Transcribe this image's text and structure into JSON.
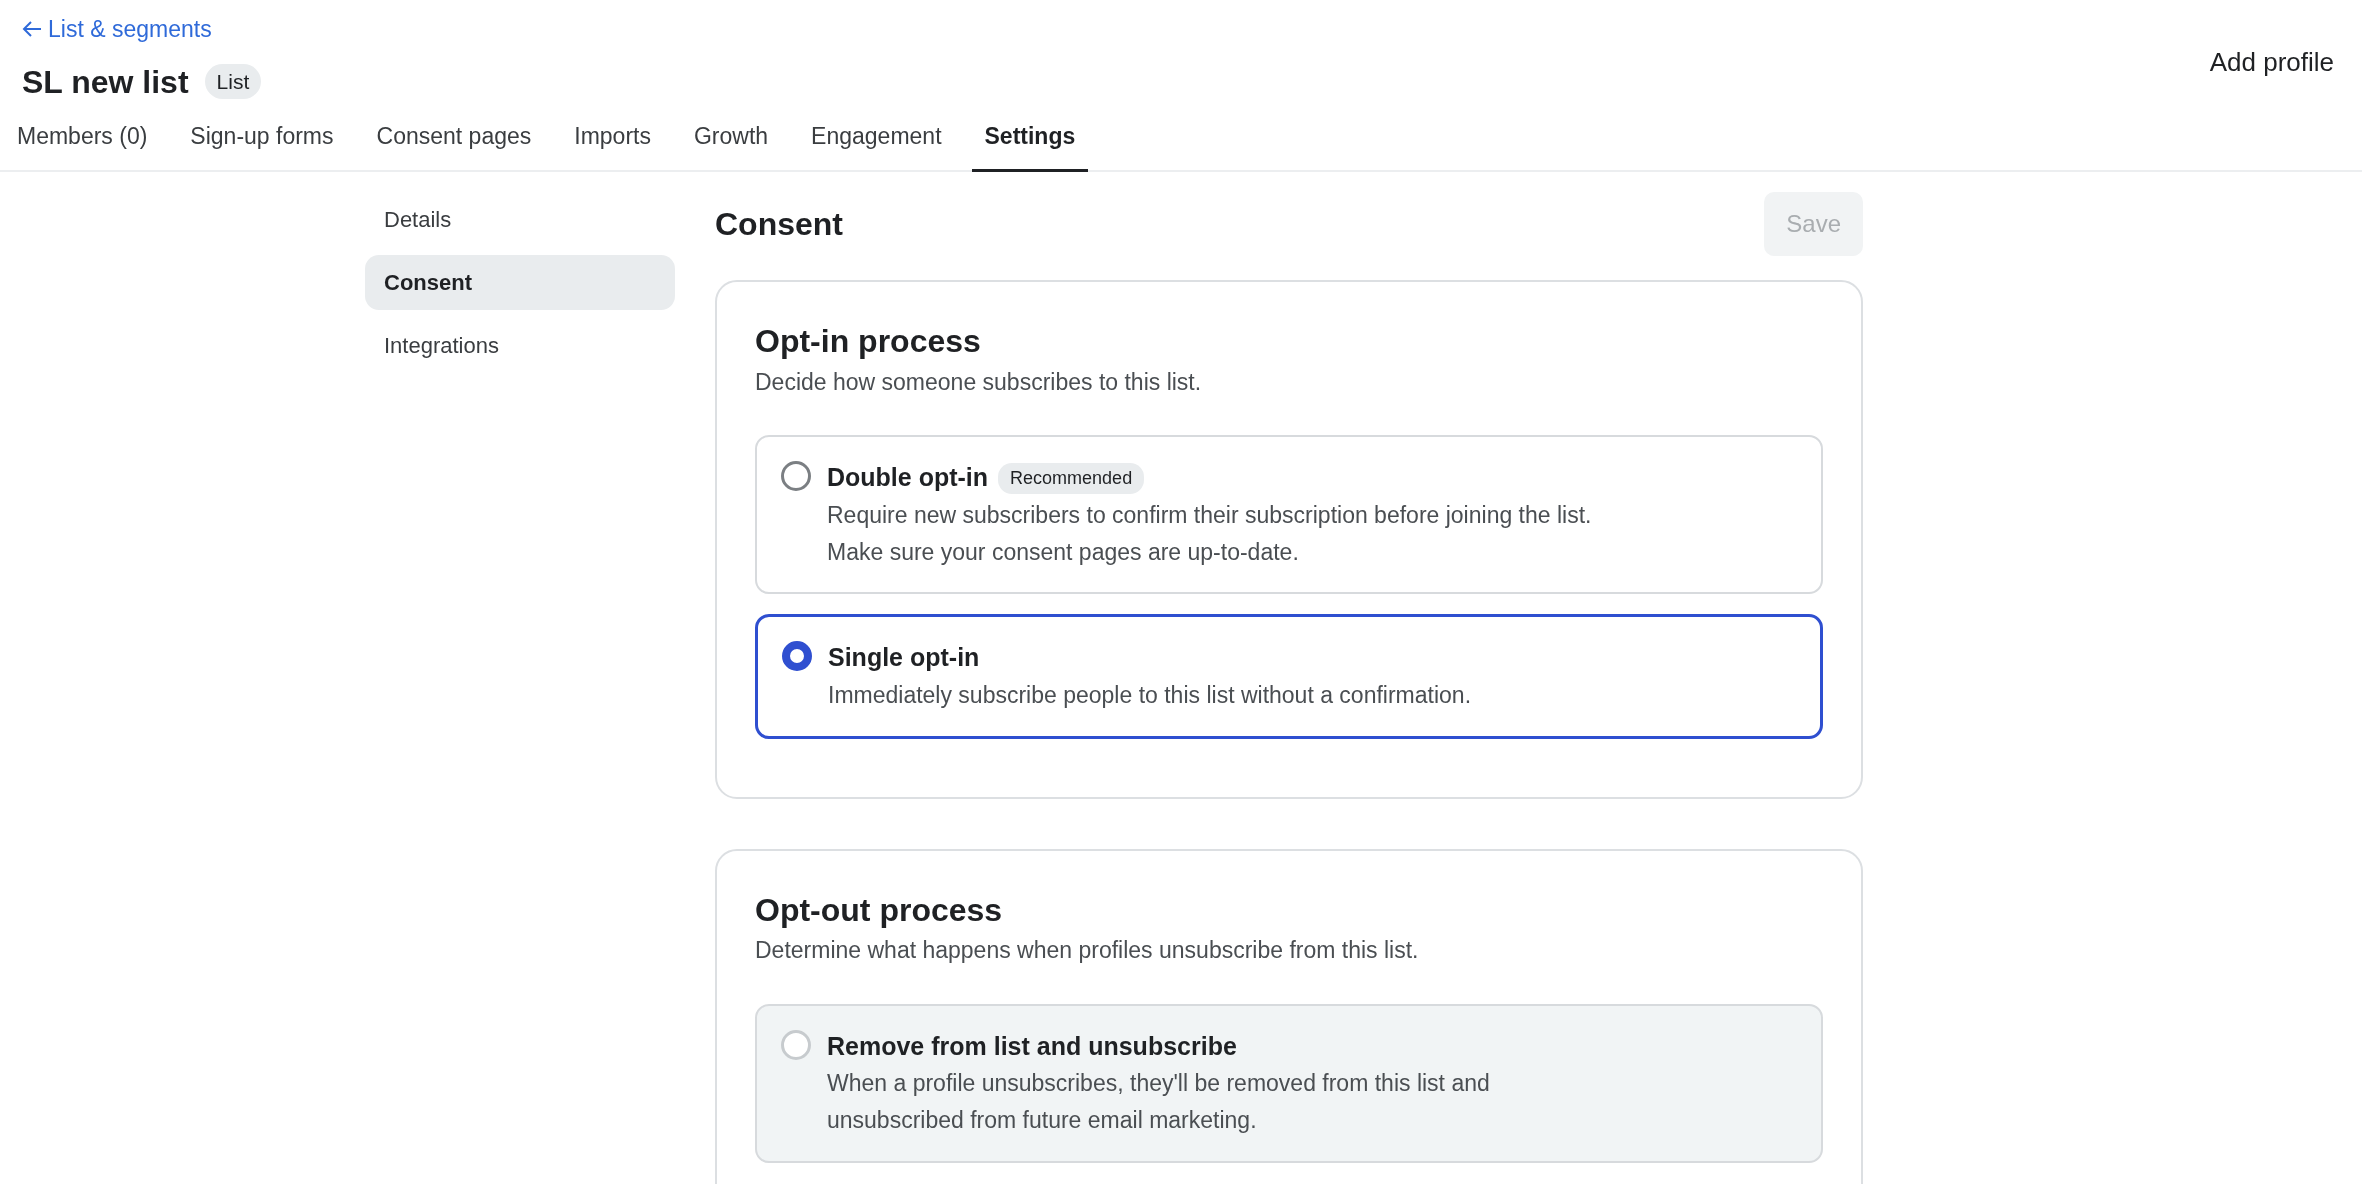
{
  "back_link": {
    "label": "List & segments"
  },
  "header": {
    "title": "SL new list",
    "badge": "List",
    "action": "Add profile"
  },
  "tabs": [
    {
      "label": "Members (0)",
      "selected": false
    },
    {
      "label": "Sign-up forms",
      "selected": false
    },
    {
      "label": "Consent pages",
      "selected": false
    },
    {
      "label": "Imports",
      "selected": false
    },
    {
      "label": "Growth",
      "selected": false
    },
    {
      "label": "Engagement",
      "selected": false
    },
    {
      "label": "Settings",
      "selected": true
    }
  ],
  "sidebar": {
    "items": [
      {
        "label": "Details",
        "selected": false
      },
      {
        "label": "Consent",
        "selected": true
      },
      {
        "label": "Integrations",
        "selected": false
      }
    ]
  },
  "content": {
    "title": "Consent",
    "save_button": {
      "label": "Save",
      "disabled": true
    },
    "sections": [
      {
        "title": "Opt-in process",
        "subtitle": "Decide how someone subscribes to this list.",
        "options": [
          {
            "title": "Double opt-in",
            "badge": "Recommended",
            "description": [
              "Require new subscribers to confirm their subscription before joining the list.",
              "Make sure your consent pages are up-to-date."
            ],
            "selected": false,
            "disabled": false
          },
          {
            "title": "Single opt-in",
            "description": [
              "Immediately subscribe people to this list without a confirmation."
            ],
            "selected": true,
            "disabled": false
          }
        ]
      },
      {
        "title": "Opt-out process",
        "subtitle": "Determine what happens when profiles unsubscribe from this list.",
        "options": [
          {
            "title": "Remove from list and unsubscribe",
            "description": [
              "When a profile unsubscribes, they'll be removed from this list and",
              "unsubscribed from future email marketing."
            ],
            "selected": false,
            "disabled": true
          }
        ]
      }
    ]
  }
}
